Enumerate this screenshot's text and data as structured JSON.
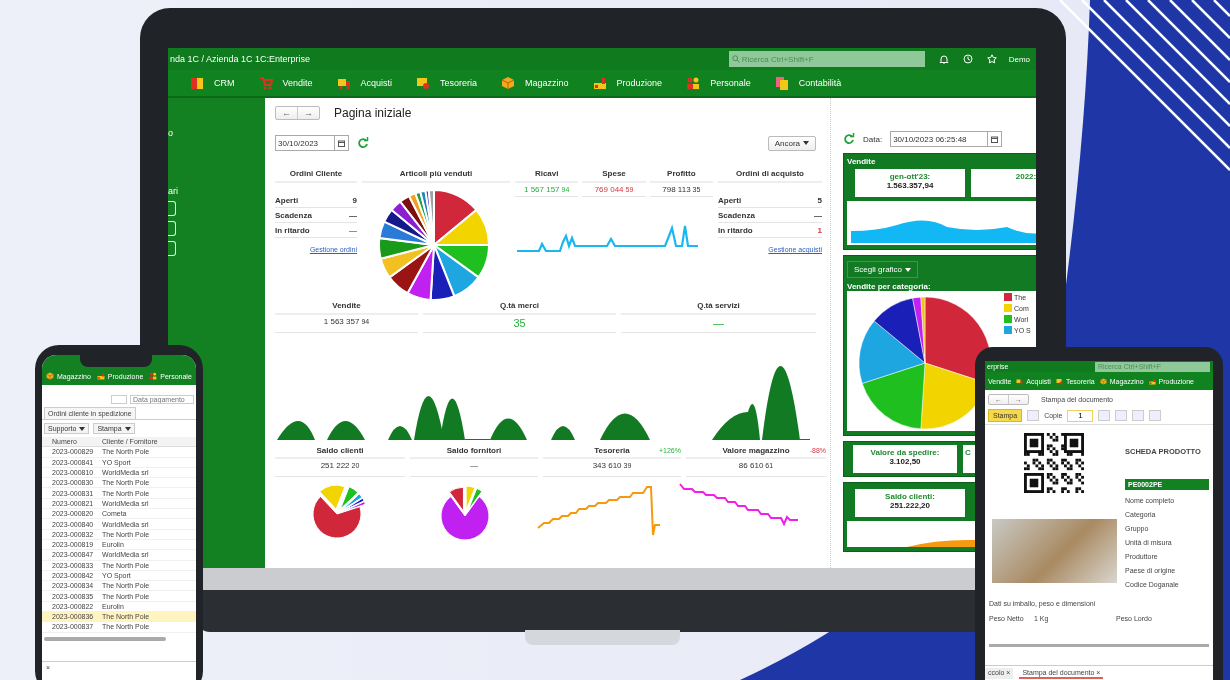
{
  "laptop": {
    "title": "nda 1C / Azienda 1C 1C:Enterprise",
    "search": {
      "placeholder": "Ricerca Ctrl+Shift+F"
    },
    "user": "Demo",
    "sections": [
      {
        "label": "CRM"
      },
      {
        "label": "Vendite"
      },
      {
        "label": "Acquisti"
      },
      {
        "label": "Tesoreria"
      },
      {
        "label": "Magazzino"
      },
      {
        "label": "Produzione"
      },
      {
        "label": "Personale"
      },
      {
        "label": "Contabilità"
      }
    ],
    "sidebar": {
      "items": [
        "o",
        "ari"
      ]
    },
    "page": {
      "back": "←",
      "forward": "→",
      "title": "Pagina iniziale",
      "date": "30/10/2023",
      "more_button": "Ancora"
    },
    "customer_orders": {
      "title": "Ordini Cliente",
      "rows": [
        {
          "label": "Aperti",
          "value": "9",
          "alert": false
        },
        {
          "label": "Scadenza",
          "value": "—",
          "alert": false
        },
        {
          "label": "In ritardo",
          "value": "—",
          "alert": true
        }
      ],
      "link": "Gestione ordini"
    },
    "top_items": {
      "title": "Articoli più venduti"
    },
    "kpis": [
      {
        "title": "Ricavi",
        "value": "1 567 157",
        "decimals": "94",
        "gain": true,
        "loss": false
      },
      {
        "title": "Spese",
        "value": "769 044",
        "decimals": "59",
        "gain": false,
        "loss": true
      },
      {
        "title": "Profitto",
        "value": "798 113",
        "decimals": "35",
        "gain": false,
        "loss": false
      }
    ],
    "purchase_orders": {
      "title": "Ordini di acquisto",
      "rows": [
        {
          "label": "Aperti",
          "value": "5",
          "alert": false
        },
        {
          "label": "Scadenza",
          "value": "—",
          "alert": false
        },
        {
          "label": "In ritardo",
          "value": "1",
          "alert": true
        }
      ],
      "link": "Gestione acquisti"
    },
    "totals": [
      {
        "title": "Vendite",
        "kind": "amount",
        "value": "1 563 357",
        "decimals": "94",
        "gain": false
      },
      {
        "title": "Q.tà merci",
        "kind": "count",
        "value": "35",
        "gain": true
      },
      {
        "title": "Q.tà servizi",
        "kind": "count",
        "value": "—",
        "gain": true
      }
    ],
    "balances": [
      {
        "title": "Saldo clienti",
        "value": "251 222",
        "decimals": "20"
      },
      {
        "title": "Saldo fornitori",
        "value": "—"
      },
      {
        "title": "Tesoreria",
        "change": "+126%",
        "change_loss": false,
        "value": "343 610",
        "decimals": "39"
      },
      {
        "title": "Valore magazzino",
        "change": "-88%",
        "change_loss": true,
        "value": "86 610",
        "decimals": "61"
      }
    ],
    "right_panel": {
      "date_label": "Data:",
      "date": "30/10/2023 06:25:48",
      "sales_title": "Vendite",
      "sales_cards": [
        {
          "label": "gen-ott'23:",
          "value": "1.563.357,94"
        },
        {
          "label": "2022:"
        }
      ],
      "chart_button": "Scegli grafico",
      "category_title": "Vendite per categoria:",
      "legend": [
        {
          "label": "The",
          "color": "#d0283a"
        },
        {
          "label": "Com",
          "color": "#f2d400"
        },
        {
          "label": "Worl",
          "color": "#1fbf1f"
        },
        {
          "label": "YO S",
          "color": "#1ea6e0"
        }
      ],
      "ship_cards": [
        {
          "label": "Valore da spedire:",
          "value": "3.102,50"
        },
        {
          "label": "C"
        }
      ],
      "balance_card": {
        "label": "Saldo clienti:",
        "value": "251.222,20"
      }
    }
  },
  "phone": {
    "sections": [
      "Magazzino",
      "Produzione",
      "Personale"
    ],
    "filter_placeholder": "Data pagamento",
    "tab": "Ordini cliente in spedizione",
    "toolbar": [
      "Supporto",
      "Stampa"
    ],
    "columns": [
      "Numero",
      "Cliente / Fornitore"
    ],
    "rows": [
      {
        "number": "2023-000829",
        "client": "The North Pole",
        "selected": false
      },
      {
        "number": "2023-000841",
        "client": "YO Sport",
        "selected": false
      },
      {
        "number": "2023-000810",
        "client": "WorldMedia srl",
        "selected": false
      },
      {
        "number": "2023-000830",
        "client": "The North Pole",
        "selected": false
      },
      {
        "number": "2023-000831",
        "client": "The North Pole",
        "selected": false
      },
      {
        "number": "2023-000821",
        "client": "WorldMedia srl",
        "selected": false
      },
      {
        "number": "2023-000820",
        "client": "Cometa",
        "selected": false
      },
      {
        "number": "2023-000840",
        "client": "WorldMedia srl",
        "selected": false
      },
      {
        "number": "2023-000832",
        "client": "The North Pole",
        "selected": false
      },
      {
        "number": "2023-000819",
        "client": "Eurolin",
        "selected": false
      },
      {
        "number": "2023-000847",
        "client": "WorldMedia srl",
        "selected": false
      },
      {
        "number": "2023-000833",
        "client": "The North Pole",
        "selected": false
      },
      {
        "number": "2023-000842",
        "client": "YO Sport",
        "selected": false
      },
      {
        "number": "2023-000834",
        "client": "The North Pole",
        "selected": false
      },
      {
        "number": "2023-000835",
        "client": "The North Pole",
        "selected": false
      },
      {
        "number": "2023-000822",
        "client": "Eurolin",
        "selected": false
      },
      {
        "number": "2023-000836",
        "client": "The North Pole",
        "selected": true
      },
      {
        "number": "2023-000837",
        "client": "The North Pole",
        "selected": false
      }
    ],
    "bottom_tab_close": "×"
  },
  "tablet": {
    "title": "erprise",
    "search": {
      "placeholder": "Ricerca Ctrl+Shift+F"
    },
    "sections": [
      "Vendite",
      "Acquisti",
      "Tesoreria",
      "Magazzino",
      "Produzione"
    ],
    "back": "←",
    "forward": "→",
    "page_title": "Stampa del documento",
    "print_button": "Stampa",
    "copies_label": "Copie",
    "copies": "1",
    "doc_title": "SCHEDA PRODOTTO",
    "code": "PE0002PE",
    "fields": [
      "Nome completo",
      "Categoria",
      "Gruppo",
      "Unità di misura",
      "Produttore",
      "Paese di origine",
      "Codice Doganale"
    ],
    "pack_title": "Dati su imballo, peso e dimensioni",
    "net_label": "Peso Netto",
    "net_value": "1 Kg",
    "gross_label": "Peso Lordo",
    "tabs": [
      {
        "label": "ccolo",
        "selected": false
      },
      {
        "label": "Stampa del documento",
        "selected": true
      }
    ],
    "tab_close": "×"
  }
}
